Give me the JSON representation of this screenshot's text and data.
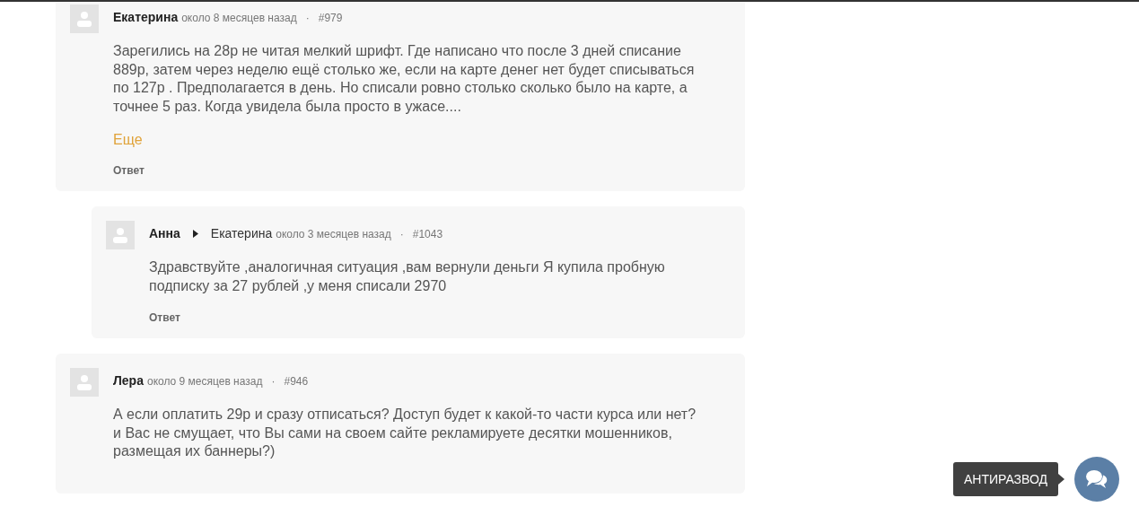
{
  "comments": [
    {
      "author": "Екатерина",
      "time": "около 8 месяцев назад",
      "separator": "·",
      "number": "#979",
      "paragraphs": [
        "Зарегились на 28р не читая мелкий шрифт. Где написано что после 3 дней списание 889р, затем через неделю ещё столько же, если на карте денег нет будет списываться по 127р . Предполагается в день. Но списали ровно столько сколько было на карте, а точнее 5 раз. Когда увидела была просто в ужасе...."
      ],
      "more_link": "Еще",
      "reply_button": "Ответ",
      "children": [
        {
          "author": "Анна",
          "reply_to": "Екатерина",
          "time": "около 3 месяцев назад",
          "separator": "·",
          "number": "#1043",
          "paragraphs": [
            "Здравствуйте ,аналогичная ситуация ,вам вернули деньги Я купила пробную подписку за 27 рублей ,у меня списали 2970"
          ],
          "reply_button": "Ответ"
        }
      ]
    },
    {
      "author": "Лера",
      "time": "около 9 месяцев назад",
      "separator": "·",
      "number": "#946",
      "paragraphs": [
        "А если оплатить 29р и сразу отписаться? Доступ будет к какой-то части курса или нет?",
        "и Вас не смущает, что Вы сами на своем сайте рекламируете десятки мошенников, размещая их баннеры?)"
      ]
    }
  ],
  "chat_widget": {
    "label": "АНТИРАЗВОД"
  }
}
